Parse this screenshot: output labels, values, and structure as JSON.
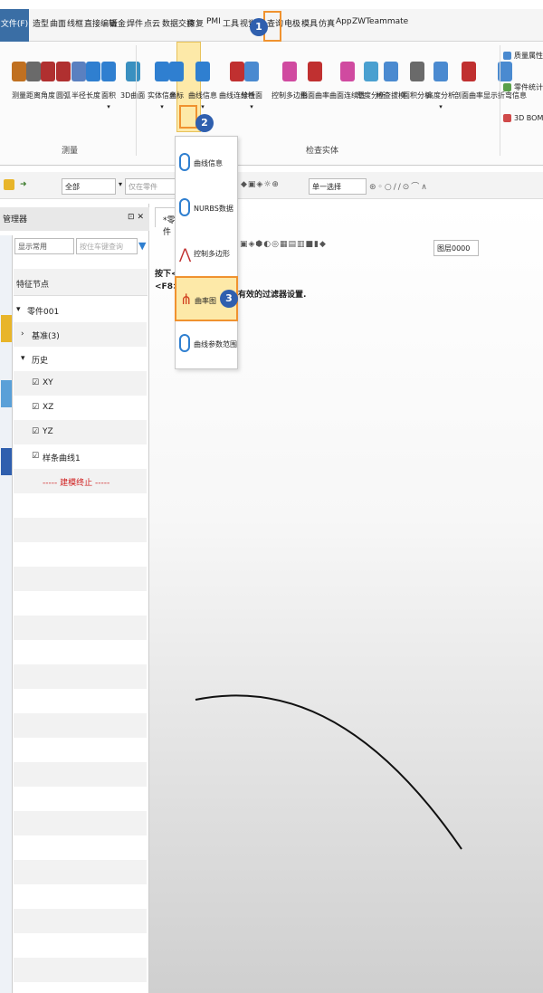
{
  "menubar": {
    "file": "文件(F)",
    "items": [
      "造型",
      "曲面",
      "线框",
      "直接编辑",
      "钣金",
      "焊件",
      "点云",
      "数据交换",
      "修复",
      "PMI",
      "工具",
      "视觉样",
      "查询",
      "电极",
      "模具",
      "仿真",
      "App",
      "ZWTeammate"
    ]
  },
  "ribbon": {
    "buttons": [
      {
        "label": "测量",
        "arrow": false
      },
      {
        "label": "距离",
        "arrow": false
      },
      {
        "label": "角度",
        "arrow": false
      },
      {
        "label": "圆弧",
        "arrow": false
      },
      {
        "label": "半径",
        "arrow": false
      },
      {
        "label": "长度",
        "arrow": false
      },
      {
        "label": "面积",
        "arrow": true
      },
      {
        "label": "3D曲面",
        "arrow": false
      },
      {
        "label": "实体信息",
        "arrow": true
      },
      {
        "label": "坐标",
        "arrow": false
      },
      {
        "label": "曲线信息",
        "arrow": true
      },
      {
        "label": "曲线连续性",
        "arrow": false
      },
      {
        "label": "分析面",
        "arrow": true
      },
      {
        "label": "控制多边形",
        "arrow": false
      },
      {
        "label": "曲面曲率",
        "arrow": false
      },
      {
        "label": "曲面连续性",
        "arrow": false
      },
      {
        "label": "厚度分析",
        "arrow": false
      },
      {
        "label": "检查拔模",
        "arrow": false
      },
      {
        "label": "面积分析",
        "arrow": false
      },
      {
        "label": "高度分析",
        "arrow": true
      },
      {
        "label": "剖面曲率",
        "arrow": false
      },
      {
        "label": "显示折弯信息",
        "arrow": false
      }
    ],
    "group_measure": "测量",
    "group_inspect": "检查实体",
    "side": [
      "质量属性",
      "零件统计",
      "3D BOM"
    ]
  },
  "toolbar": {
    "filter_value": "全部",
    "search_placeholder": "仅在零件",
    "select_value": "单一选择"
  },
  "panel": {
    "title": "管理器",
    "display_select": "显示常用",
    "search_placeholder": "按住车键查询",
    "column_header": "特征节点",
    "tree": [
      "零件001",
      "基准(3)",
      "历史",
      "XY",
      "XZ",
      "YZ",
      "样条曲线1",
      "----- 建模终止 -----"
    ]
  },
  "canvas": {
    "tab_label": "*零件",
    "hint_line1": "按下<F2",
    "hint_line2": "<F8>或",
    "hint_rest": "有效的过滤器设置.",
    "layer_value": "图层0000"
  },
  "dropdown": {
    "items": [
      "曲线信息",
      "NURBS数据",
      "控制多边形",
      "曲率图",
      "曲线参数范围"
    ]
  },
  "steps": [
    "1",
    "2",
    "3"
  ],
  "colors": {
    "accent": "#2f5fae",
    "highlight": "#f0922f",
    "file_menu": "#3a6ea5"
  }
}
